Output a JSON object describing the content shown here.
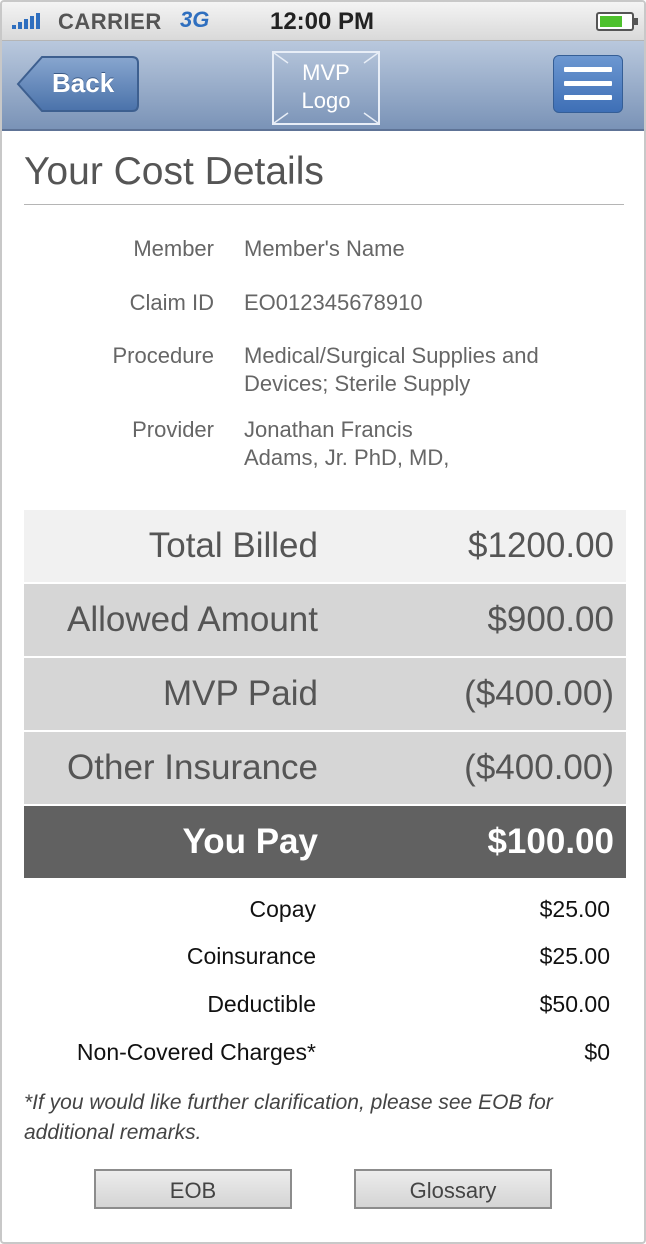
{
  "status_bar": {
    "carrier": "CARRIER",
    "network": "3G",
    "time": "12:00 PM"
  },
  "nav": {
    "back_label": "Back",
    "logo_line1": "MVP",
    "logo_line2": "Logo",
    "menu_icon": "hamburger-menu-icon"
  },
  "page": {
    "title": "Your Cost Details"
  },
  "claim_info": [
    {
      "label": "Member",
      "value": "Member's Name"
    },
    {
      "label": "Claim ID",
      "value": "EO012345678910"
    },
    {
      "label": "Procedure",
      "value_line1": "Medical/Surgical Supplies and",
      "value_line2": "Devices; Sterile Supply"
    },
    {
      "label": "Provider",
      "value_line1": "Jonathan Francis",
      "value_line2": "Adams, Jr. PhD, MD,"
    }
  ],
  "cost_summary": [
    {
      "label": "Total Billed",
      "value": "$1200.00"
    },
    {
      "label": "Allowed Amount",
      "value": "$900.00"
    },
    {
      "label": "MVP Paid",
      "value": "($400.00)"
    },
    {
      "label": "Other Insurance",
      "value": "($400.00)"
    },
    {
      "label": "You Pay",
      "value": "$100.00"
    }
  ],
  "breakdown": [
    {
      "label": "Copay",
      "value": "$25.00"
    },
    {
      "label": "Coinsurance",
      "value": "$25.00"
    },
    {
      "label": "Deductible",
      "value": "$50.00"
    },
    {
      "label": "Non-Covered Charges*",
      "value": "$0"
    }
  ],
  "footnote": "*If you would like further clarification, please see EOB for additional remarks.",
  "buttons": {
    "eob": "EOB",
    "glossary": "Glossary"
  },
  "colors": {
    "nav_bar": "#8aa1c2",
    "menu_button": "#4f7fc2",
    "you_pay_row": "#616161",
    "signal": "#2f6fbf",
    "battery": "#4ec12d"
  }
}
